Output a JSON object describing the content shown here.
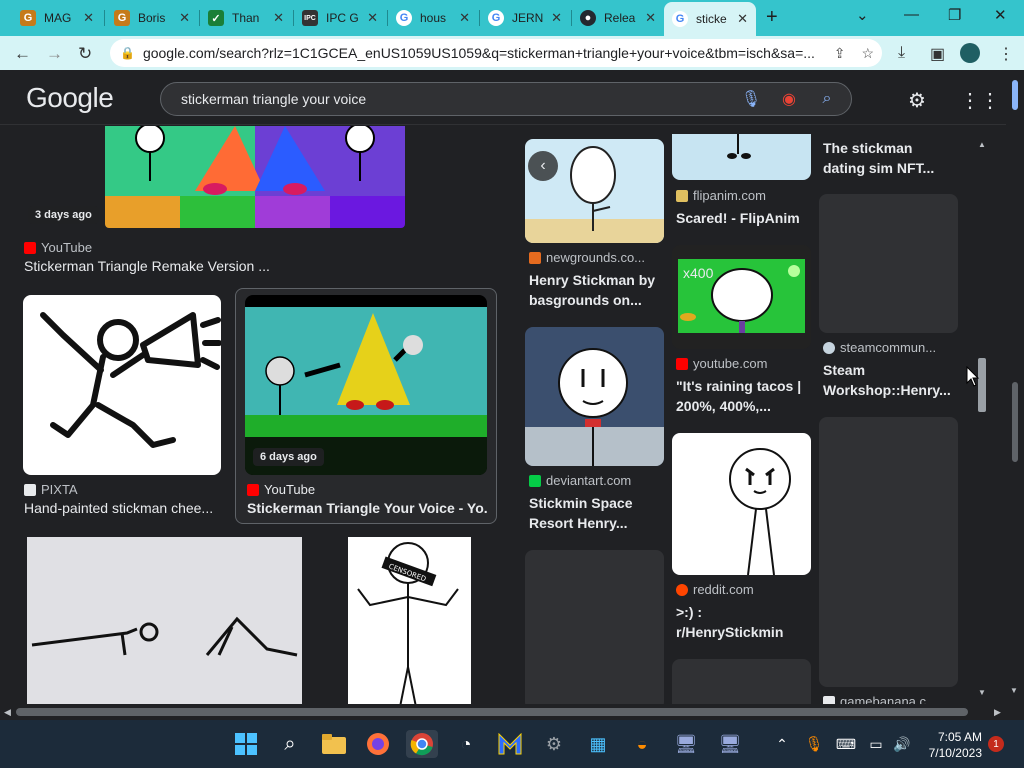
{
  "tabs": [
    {
      "title": "MAG",
      "icon": "g-icon",
      "color": "#c57b1a"
    },
    {
      "title": "Boris",
      "icon": "g-icon",
      "color": "#c57b1a"
    },
    {
      "title": "Than",
      "icon": "check-icon",
      "color": "#1a7f37"
    },
    {
      "title": "IPC G",
      "icon": "ipc-icon",
      "color": "#333333"
    },
    {
      "title": "hous",
      "icon": "google-icon",
      "color": "#ffffff"
    },
    {
      "title": "JERN",
      "icon": "google-icon",
      "color": "#ffffff"
    },
    {
      "title": "Relea",
      "icon": "github-icon",
      "color": "#24292f"
    },
    {
      "title": "sticke",
      "icon": "google-icon",
      "color": "#ffffff"
    }
  ],
  "address": {
    "url": "google.com/search?rlz=1C1GCEA_enUS1059US1059&q=stickerman+triangle+your+voice&tbm=isch&sa=..."
  },
  "google": {
    "logo": "Google",
    "query": "stickerman triangle your voice"
  },
  "results": {
    "left": [
      {
        "source": "YouTube",
        "title": "Stickerman Triangle Remake Version ...",
        "badge": "3 days ago"
      },
      {
        "source": "PIXTA",
        "title": "Hand-painted stickman chee..."
      },
      {
        "source": "YouTube",
        "title": "Stickerman Triangle Your Voice - Yo...",
        "badge": "6 days ago"
      }
    ],
    "col1": [
      {
        "source": "newgrounds.co...",
        "title": "Henry Stickman by basgrounds on..."
      },
      {
        "source": "deviantart.com",
        "title": "Stickmin Space Resort Henry..."
      }
    ],
    "col2": [
      {
        "source": "flipanim.com",
        "title": "Scared! - FlipAnim"
      },
      {
        "source": "youtube.com",
        "title": "\"It's raining tacos | 200%, 400%,...",
        "badge": "x400"
      },
      {
        "source": "reddit.com",
        "title": ">:) : r/HenryStickmin"
      }
    ],
    "col3": [
      {
        "title": "The stickman dating sim NFT..."
      },
      {
        "source": "steamcommun...",
        "title": "Steam Workshop::Henry..."
      },
      {
        "source": "gamebanana.c..."
      }
    ]
  },
  "censored_label": "CENSORED",
  "clock": {
    "time": "7:05 AM",
    "date": "7/10/2023"
  },
  "notifications": "1"
}
